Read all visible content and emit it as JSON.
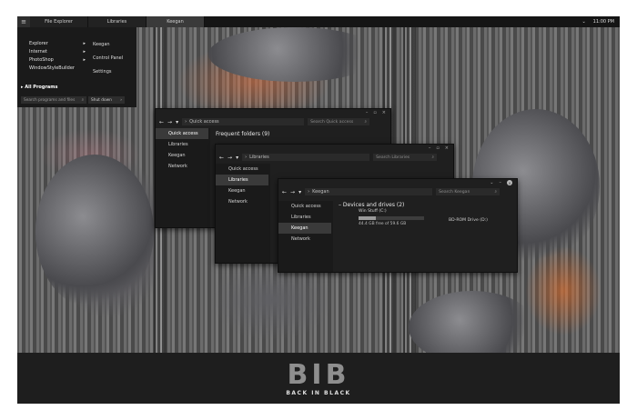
{
  "taskbar": {
    "tasks": [
      {
        "label": "File Explorer",
        "active": false
      },
      {
        "label": "Libraries",
        "active": false
      },
      {
        "label": "Keegan",
        "active": true
      }
    ],
    "clock": "11:00 PM"
  },
  "start_menu": {
    "left_items": [
      {
        "label": "Explorer",
        "arrow": "▸"
      },
      {
        "label": "Internet",
        "arrow": "▸"
      },
      {
        "label": "PhotoShop",
        "arrow": "▸"
      },
      {
        "label": "WindowStyleBuilder",
        "arrow": ""
      }
    ],
    "right_items": [
      "Keegan",
      "Control Panel",
      "Settings"
    ],
    "all_programs": "All Programs",
    "search_placeholder": "Search programs and files",
    "shutdown_label": "Shut down"
  },
  "windows": {
    "quick_access": {
      "address": "Quick access",
      "search_placeholder": "Search Quick access",
      "nav": [
        "Quick access",
        "Libraries",
        "Keegan",
        "Network"
      ],
      "selected": 0,
      "section_title": "Frequent folders (9)"
    },
    "libraries": {
      "address": "Libraries",
      "search_placeholder": "Search Libraries",
      "nav": [
        "Quick access",
        "Libraries",
        "Keegan",
        "Network"
      ],
      "selected": 1
    },
    "keegan": {
      "address": "Keegan",
      "search_placeholder": "Search Keegan",
      "nav": [
        "Quick access",
        "Libraries",
        "Keegan",
        "Network"
      ],
      "selected": 2,
      "section_title": "Devices and drives (2)",
      "drive": {
        "name": "Win Stuff (C:)",
        "free_text": "44.4 GB free of 59.6 GB",
        "used_fraction": 0.26
      },
      "cd_drive": "BD-ROM Drive (D:)"
    }
  },
  "branding": {
    "title": "BIB",
    "subtitle": "BACK IN BLACK"
  },
  "colors": {
    "dark": "#1c1c1c",
    "accent_text": "#8e8e8e",
    "drive_bar": "#9a9a9a"
  }
}
